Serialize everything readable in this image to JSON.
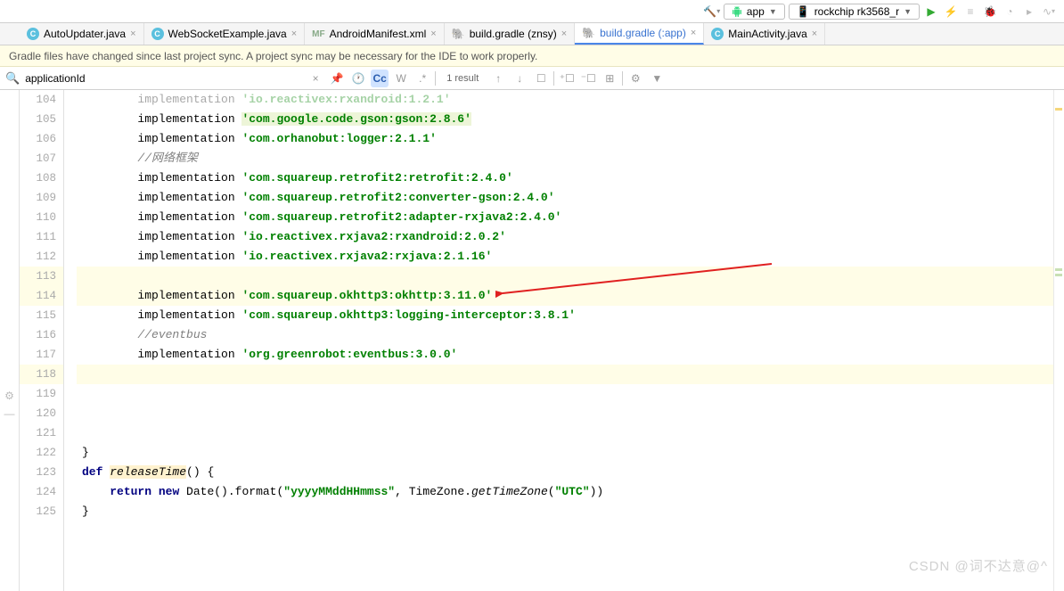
{
  "toolbar": {
    "run_config": "app",
    "device": "rockchip rk3568_r"
  },
  "tabs": [
    {
      "label": "AutoUpdater.java",
      "icon": "c",
      "active": false
    },
    {
      "label": "WebSocketExample.java",
      "icon": "c",
      "active": false
    },
    {
      "label": "AndroidManifest.xml",
      "icon": "mf",
      "active": false
    },
    {
      "label": "build.gradle (znsy)",
      "icon": "g",
      "active": false
    },
    {
      "label": "build.gradle (:app)",
      "icon": "g",
      "active": true
    },
    {
      "label": "MainActivity.java",
      "icon": "c",
      "active": false
    }
  ],
  "sync_message": "Gradle files have changed since last project sync. A project sync may be necessary for the IDE to work properly.",
  "search": {
    "value": "applicationId",
    "result": "1 result",
    "cc": "Cc",
    "w": "W"
  },
  "lines": [
    {
      "n": 104,
      "type": "impl-dim",
      "indent": "        ",
      "kw": "implementation",
      "str": "'io.reactivex:rxandroid:1.2.1'",
      "dim": true
    },
    {
      "n": 105,
      "type": "impl",
      "indent": "        ",
      "kw": "implementation",
      "str": "'com.google.code.gson:gson:2.8.6'",
      "hlstr": true
    },
    {
      "n": 106,
      "type": "impl",
      "indent": "        ",
      "kw": "implementation",
      "str": "'com.orhanobut:logger:2.1.1'"
    },
    {
      "n": 107,
      "type": "cmt",
      "indent": "        ",
      "text": "//网络框架"
    },
    {
      "n": 108,
      "type": "impl",
      "indent": "        ",
      "kw": "implementation",
      "str": "'com.squareup.retrofit2:retrofit:2.4.0'"
    },
    {
      "n": 109,
      "type": "impl",
      "indent": "        ",
      "kw": "implementation",
      "str": "'com.squareup.retrofit2:converter-gson:2.4.0'"
    },
    {
      "n": 110,
      "type": "impl",
      "indent": "        ",
      "kw": "implementation",
      "str": "'com.squareup.retrofit2:adapter-rxjava2:2.4.0'"
    },
    {
      "n": 111,
      "type": "impl",
      "indent": "        ",
      "kw": "implementation",
      "str": "'io.reactivex.rxjava2:rxandroid:2.0.2'"
    },
    {
      "n": 112,
      "type": "impl",
      "indent": "        ",
      "kw": "implementation",
      "str": "'io.reactivex.rxjava2:rxjava:2.1.16'"
    },
    {
      "n": 113,
      "type": "caret",
      "indent": "",
      "hl": true
    },
    {
      "n": 114,
      "type": "impl",
      "indent": "        ",
      "kw": "implementation",
      "str": "'com.squareup.okhttp3:okhttp:3.11.0'",
      "hl": true
    },
    {
      "n": 115,
      "type": "impl",
      "indent": "        ",
      "kw": "implementation",
      "str": "'com.squareup.okhttp3:logging-interceptor:3.8.1'"
    },
    {
      "n": 116,
      "type": "cmt",
      "indent": "        ",
      "text": "//eventbus"
    },
    {
      "n": 117,
      "type": "impl",
      "indent": "        ",
      "kw": "implementation",
      "str": "'org.greenrobot:eventbus:3.0.0'"
    },
    {
      "n": 118,
      "type": "blank",
      "hl": true
    },
    {
      "n": 119,
      "type": "blank"
    },
    {
      "n": 120,
      "type": "blank"
    },
    {
      "n": 121,
      "type": "blank"
    },
    {
      "n": 122,
      "type": "close",
      "indent": "",
      "text": "}"
    },
    {
      "n": 123,
      "type": "def",
      "indent": "",
      "def": "def",
      "fn": "releaseTime",
      "rest": "() {"
    },
    {
      "n": 124,
      "type": "ret",
      "indent": "    ",
      "ret": "return new",
      "date": "Date().format(",
      "fmt": "\"yyyyMMddHHmmss\"",
      ", TimeZone.": ", TimeZone.",
      "gtz": "getTimeZone",
      "utc": "(\"UTC\"))"
    },
    {
      "n": 125,
      "type": "close",
      "indent": "",
      "text": "}"
    }
  ],
  "ret_line": {
    "kw1": "return",
    "kw2": "new",
    "call1": "Date().format(",
    "str1": "\"yyyyMMddHHmmss\"",
    "mid": ", TimeZone.",
    "call2": "getTimeZone",
    "open": "(",
    "str2": "\"UTC\"",
    "close": "))"
  },
  "watermark": "CSDN @词不达意@^"
}
